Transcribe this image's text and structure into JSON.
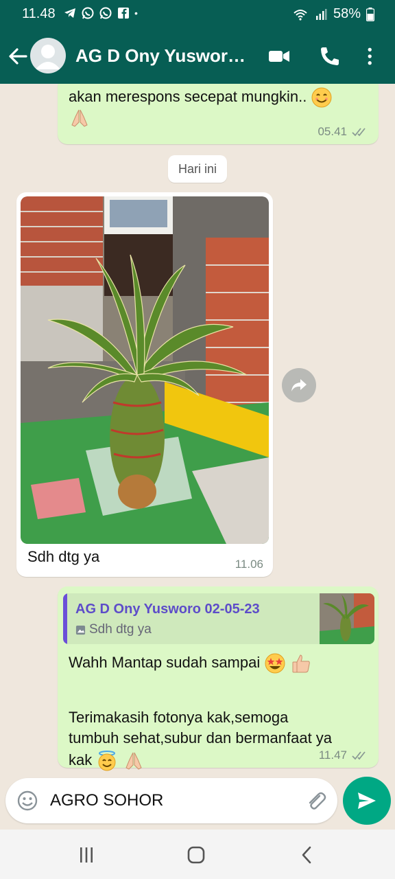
{
  "status_bar": {
    "time": "11.48",
    "battery": "58%",
    "dot": "•"
  },
  "header": {
    "contact_name": "AG D Ony Yusworo Guci Ulo",
    "icons": [
      "back-arrow-icon",
      "video-call-icon",
      "voice-call-icon",
      "more-options-icon"
    ]
  },
  "messages": [
    {
      "direction": "out",
      "text_line1": "akan merespons secepat mungkin..",
      "time": "05.41"
    },
    {
      "direction": "in",
      "caption": "Sdh dtg ya",
      "time": "11.06"
    },
    {
      "direction": "out",
      "quote_author": "AG D Ony Yusworo 02-05-23",
      "quote_text": "Sdh dtg ya",
      "line1": "Wahh Mantap sudah sampai",
      "para2_line1": "Terimakasih fotonya kak,semoga",
      "para2_line2": "tumbuh sehat,subur dan bermanfaat ya",
      "para2_line3": "kak",
      "time": "11.47"
    }
  ],
  "day_chip": "Hari ini",
  "composer": {
    "text": "AGRO SOHOR"
  },
  "colors": {
    "header": "#075e54",
    "outgoing": "#dcf8c6",
    "incoming": "#ffffff",
    "send": "#00a884",
    "quote_bar": "#6b4fd8"
  }
}
